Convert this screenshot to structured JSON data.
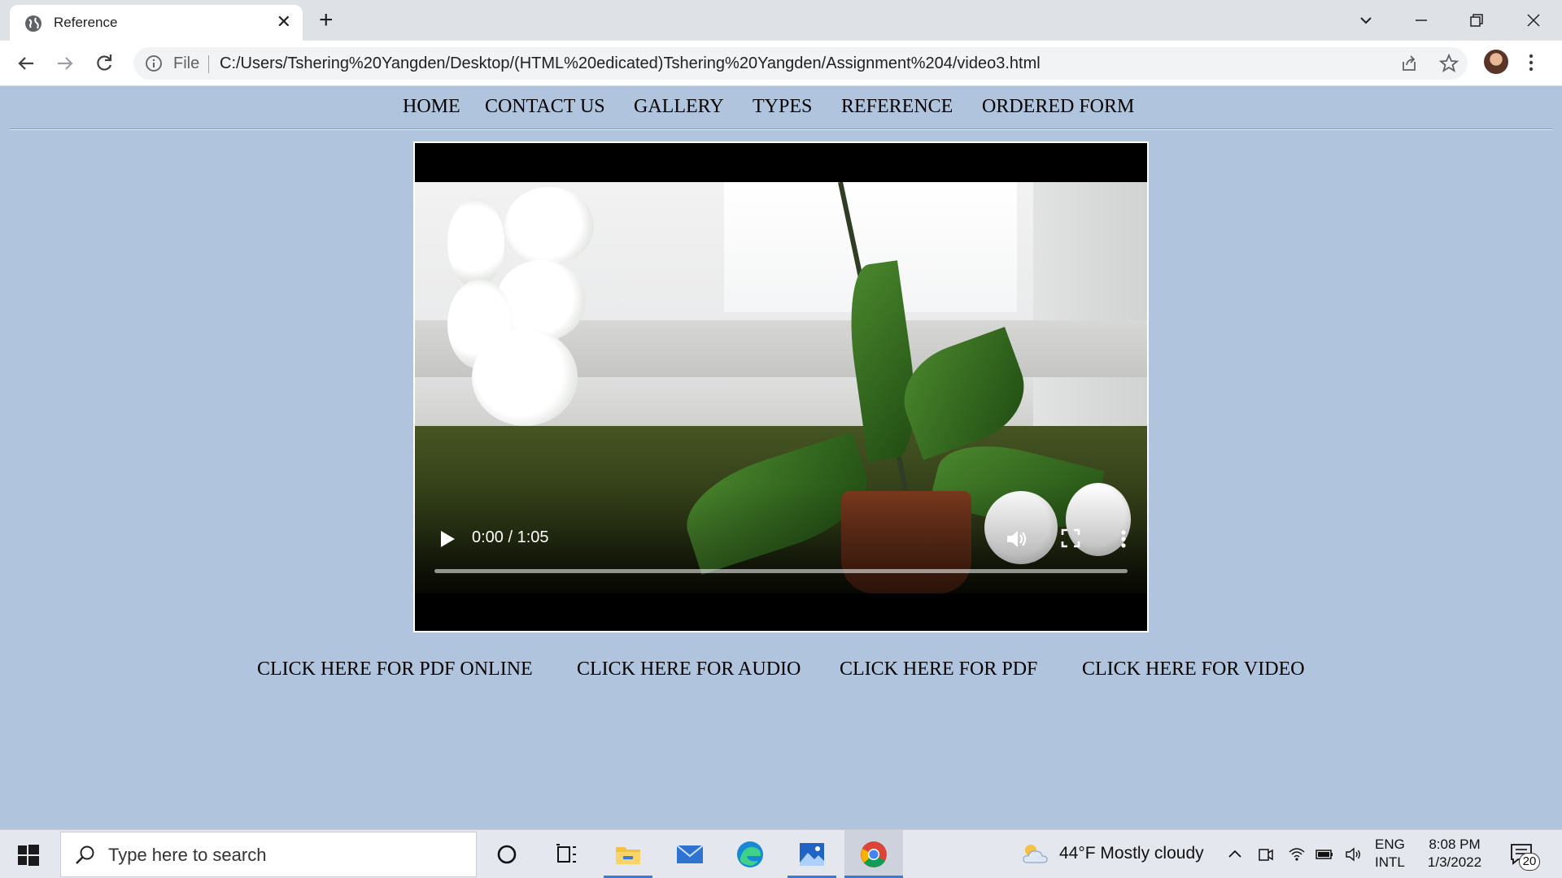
{
  "browser": {
    "tab_title": "Reference",
    "tab_close": "✕",
    "new_tab": "+",
    "address_scheme": "File",
    "url": "C:/Users/Tshering%20Yangden/Desktop/(HTML%20edicated)Tshering%20Yangden/Assignment%204/video3.html"
  },
  "nav": {
    "items": [
      "HOME",
      "CONTACT US",
      "GALLERY",
      "TYPES",
      "REFERENCE",
      "ORDERED FORM"
    ]
  },
  "video": {
    "time": "0:00 / 1:05",
    "progress_fraction": 0.0
  },
  "links": {
    "items": [
      "CLICK HERE FOR PDF ONLINE",
      "CLICK HERE FOR AUDIO",
      "CLICK HERE FOR PDF",
      "CLICK HERE FOR VIDEO"
    ]
  },
  "taskbar": {
    "search_placeholder": "Type here to search",
    "weather": "44°F  Mostly cloudy",
    "lang_line1": "ENG",
    "lang_line2": "INTL",
    "time": "8:08 PM",
    "date": "1/3/2022",
    "notification_count": "20"
  },
  "colors": {
    "page_bg": "#b0c4de",
    "tab_strip": "#dee1e6",
    "taskbar_active": "#3b7bd6"
  }
}
